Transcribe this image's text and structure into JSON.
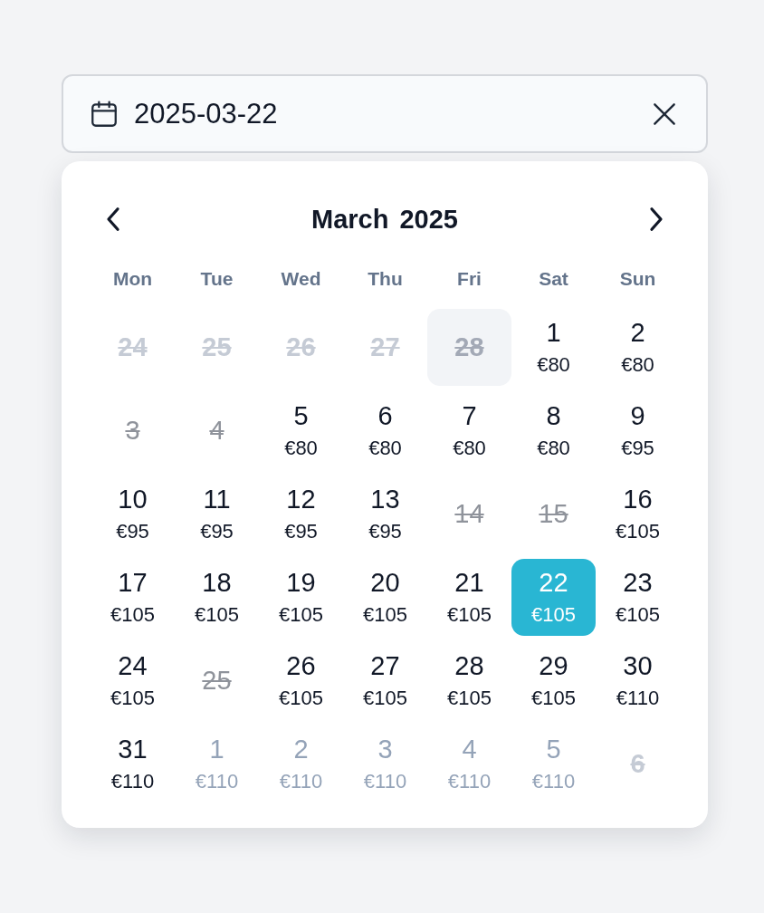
{
  "date_field": {
    "value": "2025-03-22"
  },
  "calendar": {
    "month": "March",
    "year": "2025",
    "weekdays": [
      "Mon",
      "Tue",
      "Wed",
      "Thu",
      "Fri",
      "Sat",
      "Sun"
    ],
    "days": [
      {
        "day": "24",
        "outside": true,
        "disabled": true,
        "today": false,
        "selected": false
      },
      {
        "day": "25",
        "outside": true,
        "disabled": true,
        "today": false,
        "selected": false
      },
      {
        "day": "26",
        "outside": true,
        "disabled": true,
        "today": false,
        "selected": false
      },
      {
        "day": "27",
        "outside": true,
        "disabled": true,
        "today": false,
        "selected": false
      },
      {
        "day": "28",
        "outside": true,
        "disabled": true,
        "today": true,
        "selected": false
      },
      {
        "day": "1",
        "price": "€80",
        "outside": false,
        "disabled": false,
        "today": false,
        "selected": false
      },
      {
        "day": "2",
        "price": "€80",
        "outside": false,
        "disabled": false,
        "today": false,
        "selected": false
      },
      {
        "day": "3",
        "outside": false,
        "disabled": true,
        "today": false,
        "selected": false
      },
      {
        "day": "4",
        "outside": false,
        "disabled": true,
        "today": false,
        "selected": false
      },
      {
        "day": "5",
        "price": "€80",
        "outside": false,
        "disabled": false,
        "today": false,
        "selected": false
      },
      {
        "day": "6",
        "price": "€80",
        "outside": false,
        "disabled": false,
        "today": false,
        "selected": false
      },
      {
        "day": "7",
        "price": "€80",
        "outside": false,
        "disabled": false,
        "today": false,
        "selected": false
      },
      {
        "day": "8",
        "price": "€80",
        "outside": false,
        "disabled": false,
        "today": false,
        "selected": false
      },
      {
        "day": "9",
        "price": "€95",
        "outside": false,
        "disabled": false,
        "today": false,
        "selected": false
      },
      {
        "day": "10",
        "price": "€95",
        "outside": false,
        "disabled": false,
        "today": false,
        "selected": false
      },
      {
        "day": "11",
        "price": "€95",
        "outside": false,
        "disabled": false,
        "today": false,
        "selected": false
      },
      {
        "day": "12",
        "price": "€95",
        "outside": false,
        "disabled": false,
        "today": false,
        "selected": false
      },
      {
        "day": "13",
        "price": "€95",
        "outside": false,
        "disabled": false,
        "today": false,
        "selected": false
      },
      {
        "day": "14",
        "outside": false,
        "disabled": true,
        "today": false,
        "selected": false
      },
      {
        "day": "15",
        "outside": false,
        "disabled": true,
        "today": false,
        "selected": false
      },
      {
        "day": "16",
        "price": "€105",
        "outside": false,
        "disabled": false,
        "today": false,
        "selected": false
      },
      {
        "day": "17",
        "price": "€105",
        "outside": false,
        "disabled": false,
        "today": false,
        "selected": false
      },
      {
        "day": "18",
        "price": "€105",
        "outside": false,
        "disabled": false,
        "today": false,
        "selected": false
      },
      {
        "day": "19",
        "price": "€105",
        "outside": false,
        "disabled": false,
        "today": false,
        "selected": false
      },
      {
        "day": "20",
        "price": "€105",
        "outside": false,
        "disabled": false,
        "today": false,
        "selected": false
      },
      {
        "day": "21",
        "price": "€105",
        "outside": false,
        "disabled": false,
        "today": false,
        "selected": false
      },
      {
        "day": "22",
        "price": "€105",
        "outside": false,
        "disabled": false,
        "today": false,
        "selected": true
      },
      {
        "day": "23",
        "price": "€105",
        "outside": false,
        "disabled": false,
        "today": false,
        "selected": false
      },
      {
        "day": "24",
        "price": "€105",
        "outside": false,
        "disabled": false,
        "today": false,
        "selected": false
      },
      {
        "day": "25",
        "outside": false,
        "disabled": true,
        "today": false,
        "selected": false
      },
      {
        "day": "26",
        "price": "€105",
        "outside": false,
        "disabled": false,
        "today": false,
        "selected": false
      },
      {
        "day": "27",
        "price": "€105",
        "outside": false,
        "disabled": false,
        "today": false,
        "selected": false
      },
      {
        "day": "28",
        "price": "€105",
        "outside": false,
        "disabled": false,
        "today": false,
        "selected": false
      },
      {
        "day": "29",
        "price": "€105",
        "outside": false,
        "disabled": false,
        "today": false,
        "selected": false
      },
      {
        "day": "30",
        "price": "€110",
        "outside": false,
        "disabled": false,
        "today": false,
        "selected": false
      },
      {
        "day": "31",
        "price": "€110",
        "outside": false,
        "disabled": false,
        "today": false,
        "selected": false
      },
      {
        "day": "1",
        "price": "€110",
        "outside": true,
        "disabled": false,
        "today": false,
        "selected": false
      },
      {
        "day": "2",
        "price": "€110",
        "outside": true,
        "disabled": false,
        "today": false,
        "selected": false
      },
      {
        "day": "3",
        "price": "€110",
        "outside": true,
        "disabled": false,
        "today": false,
        "selected": false
      },
      {
        "day": "4",
        "price": "€110",
        "outside": true,
        "disabled": false,
        "today": false,
        "selected": false
      },
      {
        "day": "5",
        "price": "€110",
        "outside": true,
        "disabled": false,
        "today": false,
        "selected": false
      },
      {
        "day": "6",
        "outside": true,
        "disabled": true,
        "today": false,
        "selected": false
      }
    ]
  }
}
